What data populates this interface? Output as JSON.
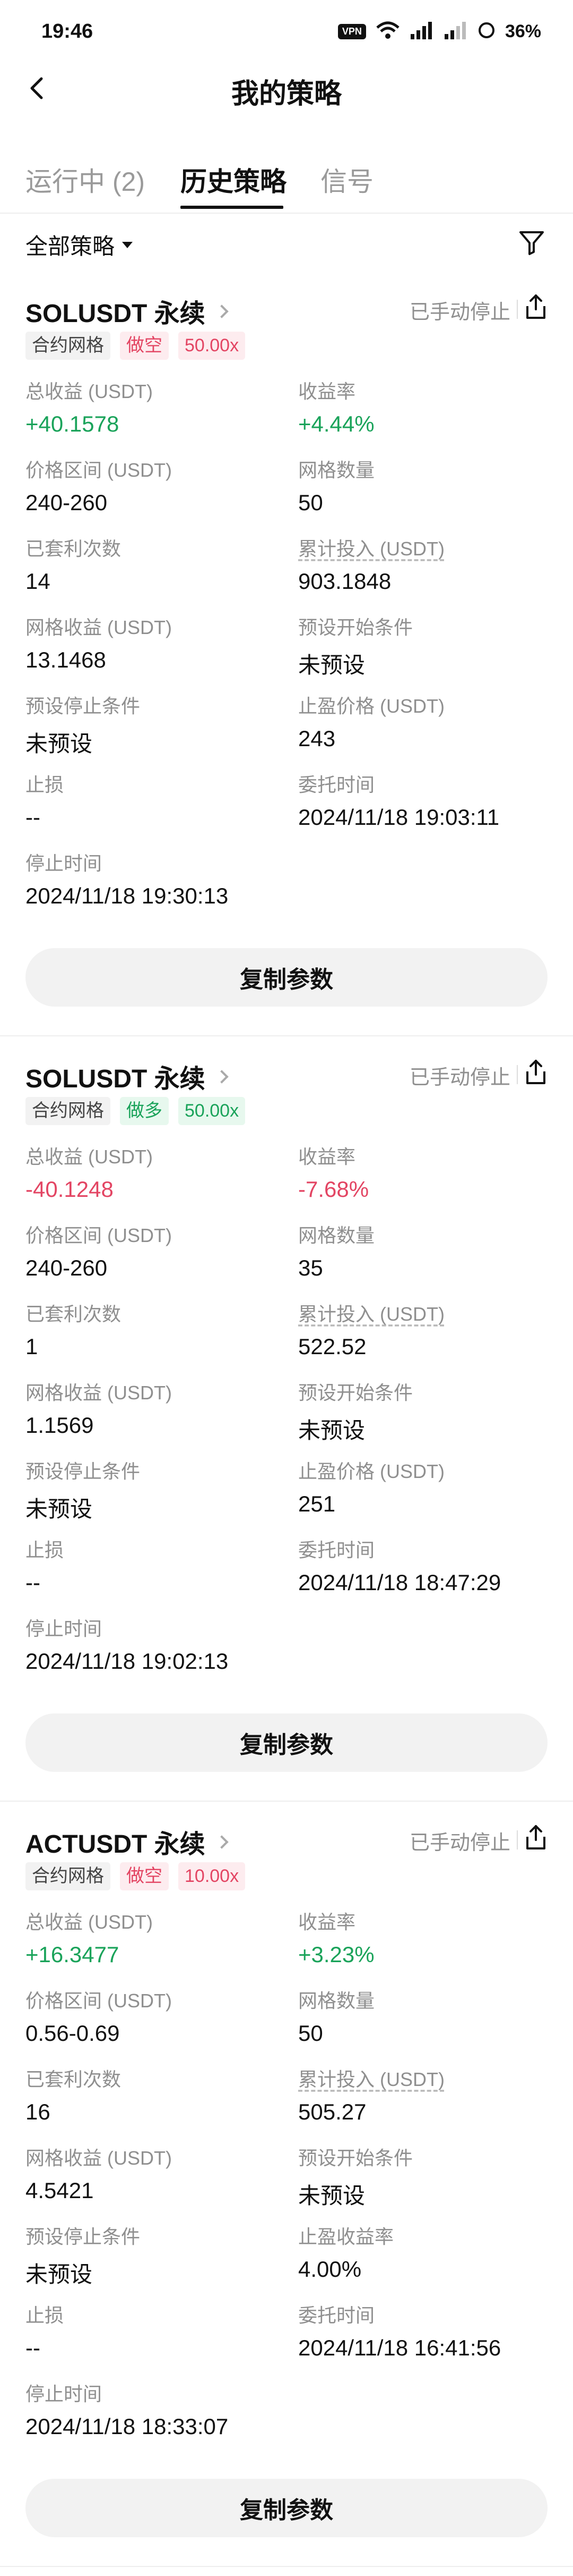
{
  "status_bar": {
    "time": "19:46",
    "vpn": "VPN",
    "battery": "36%"
  },
  "nav": {
    "title": "我的策略"
  },
  "tabs": [
    {
      "label": "运行中 (2)",
      "active": false
    },
    {
      "label": "历史策略",
      "active": true
    },
    {
      "label": "信号",
      "active": false
    }
  ],
  "filter": {
    "label": "全部策略"
  },
  "copy_label": "复制参数",
  "labels": {
    "total_pnl": "总收益 (USDT)",
    "pnl_rate": "收益率",
    "price_range": "价格区间 (USDT)",
    "grid_count": "网格数量",
    "arb_count": "已套利次数",
    "invested": "累计投入 (USDT)",
    "grid_pnl": "网格收益 (USDT)",
    "start_condition": "预设开始条件",
    "stop_condition": "预设停止条件",
    "take_profit_price": "止盈价格 (USDT)",
    "take_profit_rate": "止盈收益率",
    "stop_loss": "止损",
    "order_time": "委托时间",
    "stop_time": "停止时间"
  },
  "strategies": [
    {
      "symbol": "SOLUSDT 永续",
      "status": "已手动停止",
      "tag_type": "合约网格",
      "direction": "做空",
      "leverage": "50.00x",
      "total_pnl": "+40.1578",
      "pnl_rate": "+4.44%",
      "price_range": "240-260",
      "grid_count": "50",
      "arb_count": "14",
      "invested": "903.1848",
      "grid_pnl": "13.1468",
      "start_condition": "未预设",
      "stop_condition": "未预设",
      "take_profit_value": "243",
      "stop_loss": "--",
      "order_time": "2024/11/18 19:03:11",
      "stop_time": "2024/11/18 19:30:13"
    },
    {
      "symbol": "SOLUSDT 永续",
      "status": "已手动停止",
      "tag_type": "合约网格",
      "direction": "做多",
      "leverage": "50.00x",
      "total_pnl": "-40.1248",
      "pnl_rate": "-7.68%",
      "price_range": "240-260",
      "grid_count": "35",
      "arb_count": "1",
      "invested": "522.52",
      "grid_pnl": "1.1569",
      "start_condition": "未预设",
      "stop_condition": "未预设",
      "take_profit_value": "251",
      "stop_loss": "--",
      "order_time": "2024/11/18 18:47:29",
      "stop_time": "2024/11/18 19:02:13"
    },
    {
      "symbol": "ACTUSDT 永续",
      "status": "已手动停止",
      "tag_type": "合约网格",
      "direction": "做空",
      "leverage": "10.00x",
      "total_pnl": "+16.3477",
      "pnl_rate": "+3.23%",
      "price_range": "0.56-0.69",
      "grid_count": "50",
      "arb_count": "16",
      "invested": "505.27",
      "grid_pnl": "4.5421",
      "start_condition": "未预设",
      "stop_condition": "未预设",
      "take_profit_value": "4.00%",
      "stop_loss": "--",
      "order_time": "2024/11/18 16:41:56",
      "stop_time": "2024/11/18 18:33:07"
    }
  ]
}
